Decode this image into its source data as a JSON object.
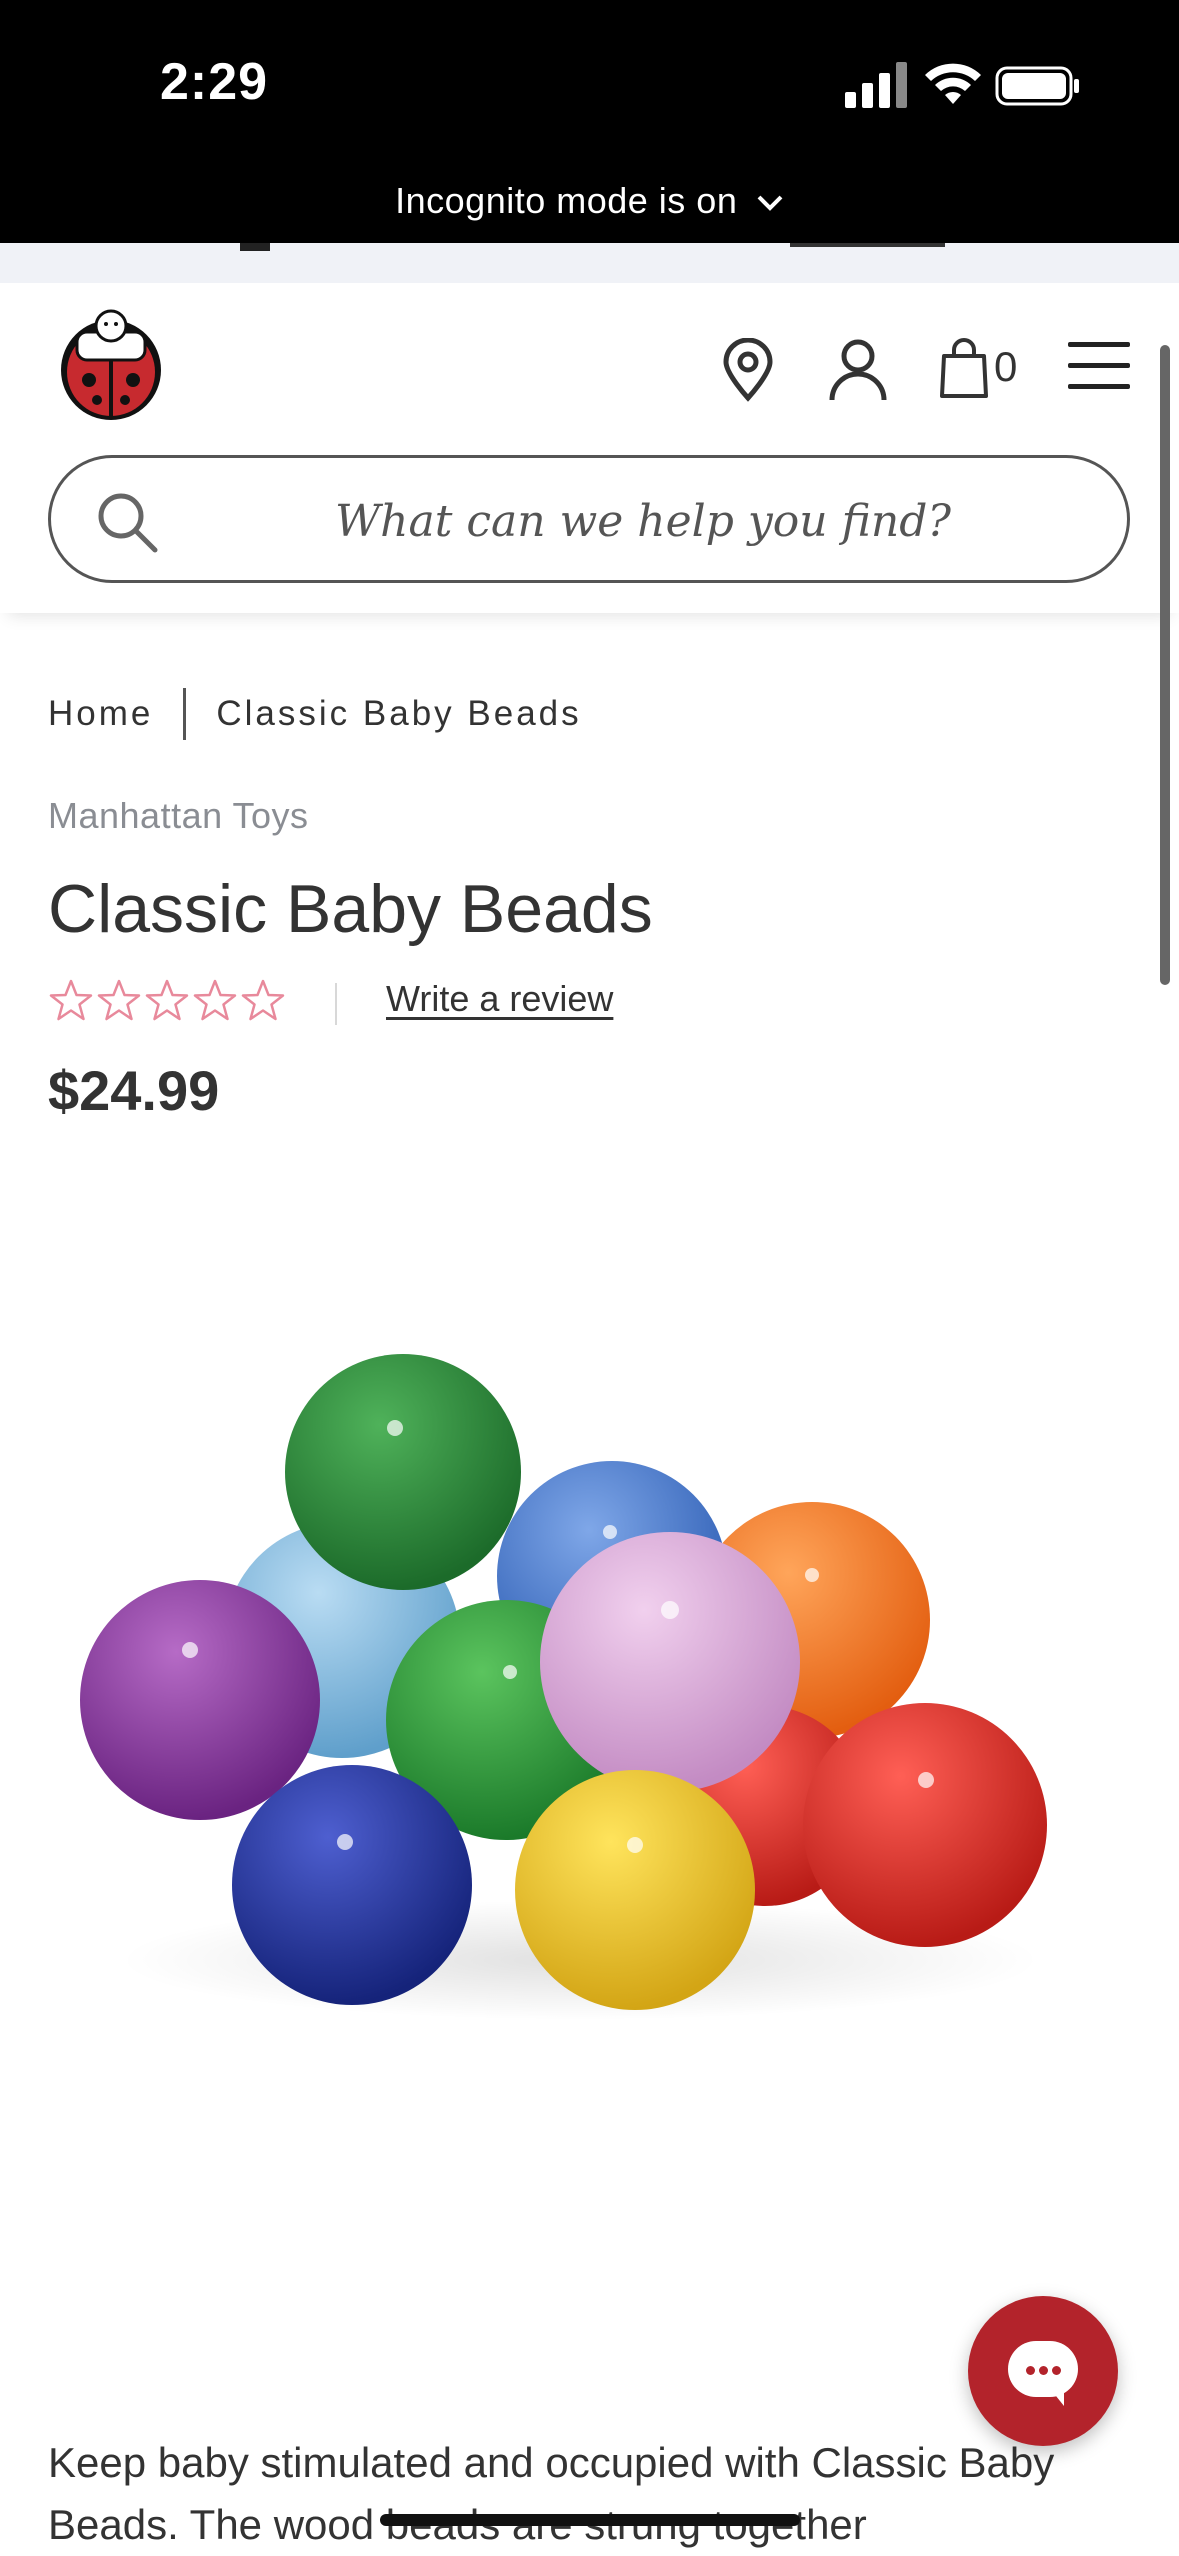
{
  "status_bar": {
    "time": "2:29",
    "incognito_label": "Incognito mode is on"
  },
  "header": {
    "logo_alt": "ladybug logo",
    "cart_count": "0",
    "icons": [
      "location-pin-icon",
      "user-icon",
      "shopping-bag-icon",
      "menu-icon"
    ]
  },
  "search": {
    "placeholder": "What can we help you find?"
  },
  "breadcrumb": {
    "items": [
      "Home",
      "Classic Baby Beads"
    ]
  },
  "product": {
    "brand": "Manhattan Toys",
    "title": "Classic Baby Beads",
    "rating": 0,
    "rating_max": 5,
    "write_review": "Write a review",
    "price": "$24.99",
    "description": "Keep baby stimulated and occupied with Classic Baby Beads. The wood beads are strung together"
  },
  "colors": {
    "accent_red": "#b3232b",
    "star_pink": "#e8899b",
    "brand_gray": "#8a8d93"
  }
}
